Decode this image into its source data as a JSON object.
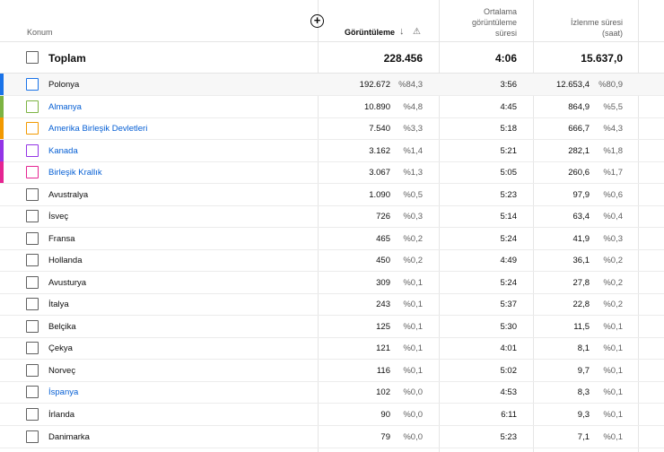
{
  "header": {
    "location": "Konum",
    "views": "Görüntüleme",
    "sort_icon": "↓",
    "warn_icon": "⚠",
    "add_icon": "+",
    "avg_duration": [
      "Ortalama",
      "görüntüleme",
      "süresi"
    ],
    "watch_time": [
      "İzlenme süresi",
      "(saat)"
    ]
  },
  "total": {
    "label": "Toplam",
    "views": "228.456",
    "avg": "4:06",
    "watch": "15.637,0"
  },
  "rows": [
    {
      "name": "Polonya",
      "views": "192.672",
      "views_pct": "%84,3",
      "avg": "3:56",
      "watch": "12.653,4",
      "watch_pct": "%80,9",
      "color": "#1a73e8",
      "selected": true,
      "link": false
    },
    {
      "name": "Almanya",
      "views": "10.890",
      "views_pct": "%4,8",
      "avg": "4:45",
      "watch": "864,9",
      "watch_pct": "%5,5",
      "color": "#7cb342",
      "selected": true,
      "link": true
    },
    {
      "name": "Amerika Birleşik Devletleri",
      "views": "7.540",
      "views_pct": "%3,3",
      "avg": "5:18",
      "watch": "666,7",
      "watch_pct": "%4,3",
      "color": "#f29900",
      "selected": true,
      "link": true
    },
    {
      "name": "Kanada",
      "views": "3.162",
      "views_pct": "%1,4",
      "avg": "5:21",
      "watch": "282,1",
      "watch_pct": "%1,8",
      "color": "#9334e6",
      "selected": true,
      "link": true
    },
    {
      "name": "Birleşik Krallık",
      "views": "3.067",
      "views_pct": "%1,3",
      "avg": "5:05",
      "watch": "260,6",
      "watch_pct": "%1,7",
      "color": "#e52592",
      "selected": true,
      "link": true
    },
    {
      "name": "Avustralya",
      "views": "1.090",
      "views_pct": "%0,5",
      "avg": "5:23",
      "watch": "97,9",
      "watch_pct": "%0,6",
      "color": "",
      "selected": false,
      "link": false
    },
    {
      "name": "İsveç",
      "views": "726",
      "views_pct": "%0,3",
      "avg": "5:14",
      "watch": "63,4",
      "watch_pct": "%0,4",
      "color": "",
      "selected": false,
      "link": false
    },
    {
      "name": "Fransa",
      "views": "465",
      "views_pct": "%0,2",
      "avg": "5:24",
      "watch": "41,9",
      "watch_pct": "%0,3",
      "color": "",
      "selected": false,
      "link": false
    },
    {
      "name": "Hollanda",
      "views": "450",
      "views_pct": "%0,2",
      "avg": "4:49",
      "watch": "36,1",
      "watch_pct": "%0,2",
      "color": "",
      "selected": false,
      "link": false
    },
    {
      "name": "Avusturya",
      "views": "309",
      "views_pct": "%0,1",
      "avg": "5:24",
      "watch": "27,8",
      "watch_pct": "%0,2",
      "color": "",
      "selected": false,
      "link": false
    },
    {
      "name": "İtalya",
      "views": "243",
      "views_pct": "%0,1",
      "avg": "5:37",
      "watch": "22,8",
      "watch_pct": "%0,2",
      "color": "",
      "selected": false,
      "link": false
    },
    {
      "name": "Belçika",
      "views": "125",
      "views_pct": "%0,1",
      "avg": "5:30",
      "watch": "11,5",
      "watch_pct": "%0,1",
      "color": "",
      "selected": false,
      "link": false
    },
    {
      "name": "Çekya",
      "views": "121",
      "views_pct": "%0,1",
      "avg": "4:01",
      "watch": "8,1",
      "watch_pct": "%0,1",
      "color": "",
      "selected": false,
      "link": false
    },
    {
      "name": "Norveç",
      "views": "116",
      "views_pct": "%0,1",
      "avg": "5:02",
      "watch": "9,7",
      "watch_pct": "%0,1",
      "color": "",
      "selected": false,
      "link": false
    },
    {
      "name": "İspanya",
      "views": "102",
      "views_pct": "%0,0",
      "avg": "4:53",
      "watch": "8,3",
      "watch_pct": "%0,1",
      "color": "",
      "selected": false,
      "link": true
    },
    {
      "name": "İrlanda",
      "views": "90",
      "views_pct": "%0,0",
      "avg": "6:11",
      "watch": "9,3",
      "watch_pct": "%0,1",
      "color": "",
      "selected": false,
      "link": false
    },
    {
      "name": "Danimarka",
      "views": "79",
      "views_pct": "%0,0",
      "avg": "5:23",
      "watch": "7,1",
      "watch_pct": "%0,1",
      "color": "",
      "selected": false,
      "link": false
    }
  ]
}
